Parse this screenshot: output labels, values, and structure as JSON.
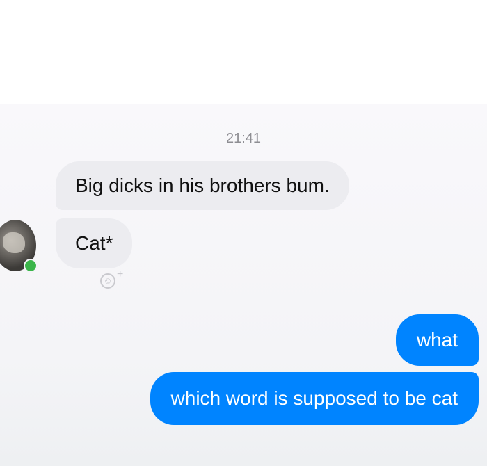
{
  "conversation": {
    "timestamp": "21:41",
    "incoming": [
      {
        "text": "Big dicks in his brothers bum."
      },
      {
        "text": "Cat*"
      }
    ],
    "outgoing": [
      {
        "text": "what"
      },
      {
        "text": "which word is supposed to be cat"
      }
    ],
    "react_icon": "smiley-plus-icon",
    "presence_color": "#3bb54a",
    "outgoing_color": "#0084ff",
    "incoming_color": "#ececf0"
  }
}
